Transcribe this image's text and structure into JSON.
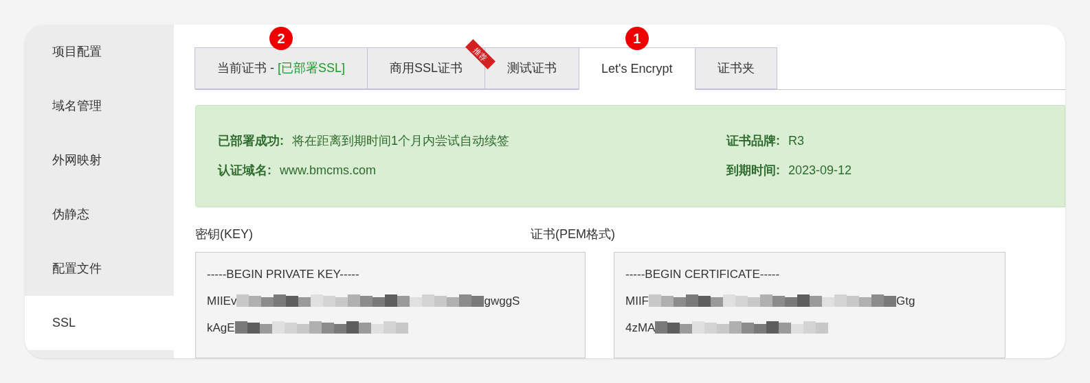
{
  "sidebar": {
    "items": [
      {
        "label": "项目配置",
        "selected": false
      },
      {
        "label": "域名管理",
        "selected": false
      },
      {
        "label": "外网映射",
        "selected": false
      },
      {
        "label": "伪静态",
        "selected": false
      },
      {
        "label": "配置文件",
        "selected": false
      },
      {
        "label": "SSL",
        "selected": true
      }
    ]
  },
  "tabs": [
    {
      "label": "当前证书 - ",
      "status": "[已部署SSL]",
      "selected": false,
      "badge": "2"
    },
    {
      "label": "商用SSL证书",
      "ribbon": "推荐",
      "selected": false
    },
    {
      "label": "测试证书",
      "selected": false
    },
    {
      "label": "Let's Encrypt",
      "selected": true,
      "badge": "1"
    },
    {
      "label": "证书夹",
      "selected": false
    }
  ],
  "status_panel": {
    "rows": [
      {
        "label": "已部署成功:",
        "value": "将在距离到期时间1个月内尝试自动续签",
        "label2": "证书品牌:",
        "value2": "R3"
      },
      {
        "label": "认证域名:",
        "value": "www.bmcms.com",
        "label2": "到期时间:",
        "value2": "2023-09-12"
      }
    ]
  },
  "key": {
    "label": "密钥(KEY)",
    "lines": [
      {
        "text": "-----BEGIN PRIVATE KEY-----"
      },
      {
        "before": "MIIEv",
        "after": "gwggS"
      },
      {
        "before": "kAgE"
      }
    ]
  },
  "certificate": {
    "label": "证书(PEM格式)",
    "lines": [
      {
        "text": "-----BEGIN CERTIFICATE-----"
      },
      {
        "before": "MIIF",
        "after": "Gtg"
      },
      {
        "before": "4zMA"
      }
    ]
  }
}
